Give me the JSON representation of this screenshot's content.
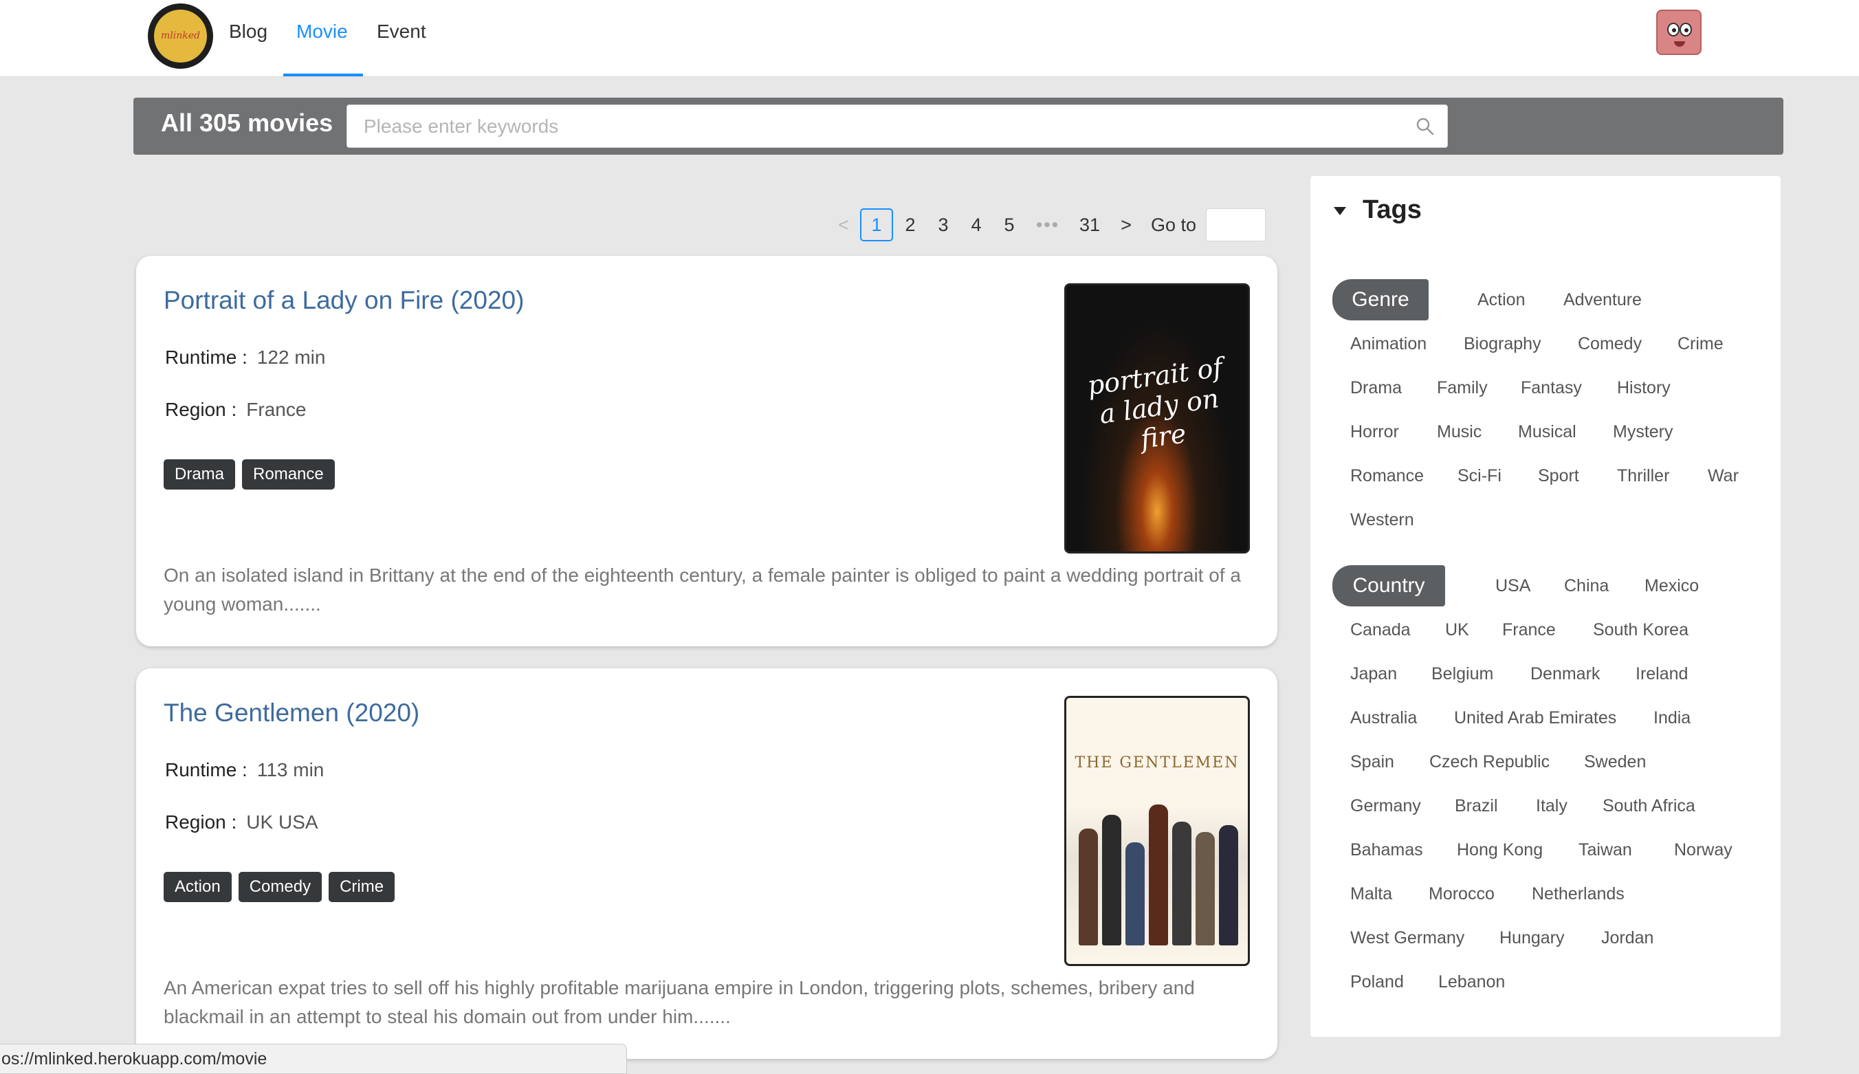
{
  "header": {
    "logo_text": "mlinked",
    "nav": [
      "Blog",
      "Movie",
      "Event"
    ],
    "active_nav": "Movie",
    "accent_color": "#1890ff"
  },
  "search": {
    "count_label": "All 305 movies",
    "placeholder": "Please enter keywords",
    "icon": "search-icon"
  },
  "pagination": {
    "prev": "<",
    "pages": [
      "1",
      "2",
      "3",
      "4",
      "5"
    ],
    "current": "1",
    "ellipsis": "•••",
    "last": "31",
    "next": ">",
    "goto_label": "Go to"
  },
  "movies": [
    {
      "title": "Portrait of a Lady on Fire (2020)",
      "runtime_label": "Runtime :",
      "runtime": "122 min",
      "region_label": "Region :",
      "region": "France",
      "tags": [
        "Drama",
        "Romance"
      ],
      "description": "On an isolated island in Brittany at the end of the eighteenth century, a female painter is obliged to paint a wedding portrait of a young woman.......",
      "poster_text": "portrait of a lady on fire"
    },
    {
      "title": "The Gentlemen (2020)",
      "runtime_label": "Runtime :",
      "runtime": "113 min",
      "region_label": "Region :",
      "region": "UK USA",
      "tags": [
        "Action",
        "Comedy",
        "Crime"
      ],
      "description": "An American expat tries to sell off his highly profitable marijuana empire in London, triggering plots, schemes, bribery and blackmail in an attempt to steal his domain out from under him.......",
      "poster_text": "THE GENTLEMEN"
    }
  ],
  "sidebar": {
    "title": "Tags",
    "genre_label": "Genre",
    "genres": [
      "Action",
      "Adventure",
      "Animation",
      "Biography",
      "Comedy",
      "Crime",
      "Drama",
      "Family",
      "Fantasy",
      "History",
      "Horror",
      "Music",
      "Musical",
      "Mystery",
      "Romance",
      "Sci-Fi",
      "Sport",
      "Thriller",
      "War",
      "Western"
    ],
    "country_label": "Country",
    "countries": [
      "USA",
      "China",
      "Mexico",
      "Canada",
      "UK",
      "France",
      "South Korea",
      "Japan",
      "Belgium",
      "Denmark",
      "Ireland",
      "Australia",
      "United Arab Emirates",
      "India",
      "Spain",
      "Czech Republic",
      "Sweden",
      "Germany",
      "Brazil",
      "Italy",
      "South Africa",
      "Bahamas",
      "Hong Kong",
      "Taiwan",
      "Norway",
      "Malta",
      "Morocco",
      "Netherlands",
      "West Germany",
      "Hungary",
      "Jordan",
      "Poland",
      "Lebanon"
    ]
  },
  "status_bar": {
    "url": "os://mlinked.herokuapp.com/movie"
  }
}
